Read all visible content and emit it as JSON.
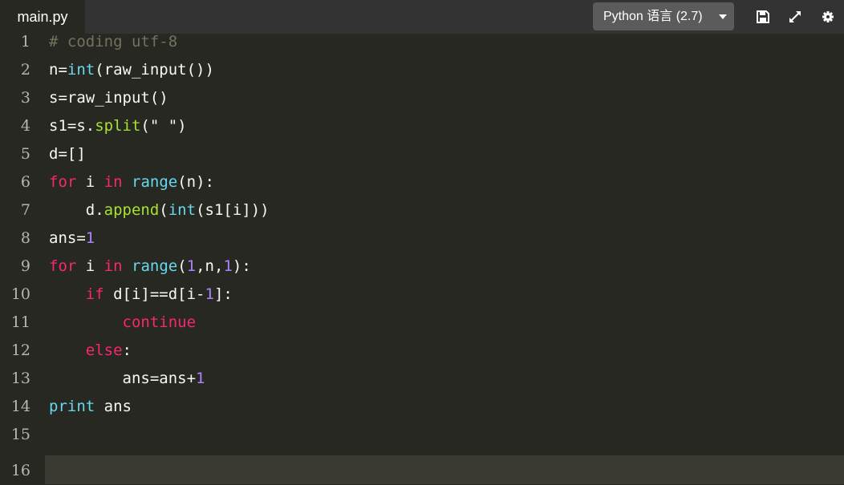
{
  "editor": {
    "tab_title": "main.py",
    "language": "Python 语言 (2.7)",
    "icons": {
      "save": "save-icon",
      "expand": "expand-icon",
      "settings": "gear-icon"
    },
    "lines": [
      {
        "n": "1",
        "tokens": [
          {
            "t": "# coding utf-8",
            "c": "com"
          }
        ]
      },
      {
        "n": "2",
        "tokens": [
          {
            "t": "n="
          },
          {
            "t": "int",
            "c": "bi"
          },
          {
            "t": "(raw_input())"
          }
        ]
      },
      {
        "n": "3",
        "tokens": [
          {
            "t": "s=raw_input()"
          }
        ]
      },
      {
        "n": "4",
        "tokens": [
          {
            "t": "s1=s."
          },
          {
            "t": "split",
            "c": "fn"
          },
          {
            "t": "(\" \")"
          }
        ]
      },
      {
        "n": "5",
        "tokens": [
          {
            "t": "d=[]"
          }
        ]
      },
      {
        "n": "6",
        "tokens": [
          {
            "t": "for",
            "c": "kw"
          },
          {
            "t": " i "
          },
          {
            "t": "in",
            "c": "kw"
          },
          {
            "t": " "
          },
          {
            "t": "range",
            "c": "bi"
          },
          {
            "t": "(n):"
          }
        ]
      },
      {
        "n": "7",
        "tokens": [
          {
            "t": "    d."
          },
          {
            "t": "append",
            "c": "fn"
          },
          {
            "t": "("
          },
          {
            "t": "int",
            "c": "bi"
          },
          {
            "t": "(s1[i]))"
          }
        ]
      },
      {
        "n": "8",
        "tokens": [
          {
            "t": "ans="
          },
          {
            "t": "1",
            "c": "num"
          }
        ]
      },
      {
        "n": "9",
        "tokens": [
          {
            "t": "for",
            "c": "kw"
          },
          {
            "t": " i "
          },
          {
            "t": "in",
            "c": "kw"
          },
          {
            "t": " "
          },
          {
            "t": "range",
            "c": "bi"
          },
          {
            "t": "("
          },
          {
            "t": "1",
            "c": "num"
          },
          {
            "t": ",n,"
          },
          {
            "t": "1",
            "c": "num"
          },
          {
            "t": "):"
          }
        ]
      },
      {
        "n": "10",
        "tokens": [
          {
            "t": "    "
          },
          {
            "t": "if",
            "c": "kw"
          },
          {
            "t": " d[i]==d[i-"
          },
          {
            "t": "1",
            "c": "num"
          },
          {
            "t": "]:"
          }
        ]
      },
      {
        "n": "11",
        "tokens": [
          {
            "t": "        "
          },
          {
            "t": "continue",
            "c": "kw"
          }
        ]
      },
      {
        "n": "12",
        "tokens": [
          {
            "t": "    "
          },
          {
            "t": "else",
            "c": "kw"
          },
          {
            "t": ":"
          }
        ]
      },
      {
        "n": "13",
        "tokens": [
          {
            "t": "        ans=ans+"
          },
          {
            "t": "1",
            "c": "num"
          }
        ]
      },
      {
        "n": "14",
        "tokens": [
          {
            "t": "print",
            "c": "bi"
          },
          {
            "t": " ans"
          }
        ]
      },
      {
        "n": "15",
        "tokens": []
      },
      {
        "n": "16",
        "tokens": [],
        "active": true
      }
    ]
  }
}
